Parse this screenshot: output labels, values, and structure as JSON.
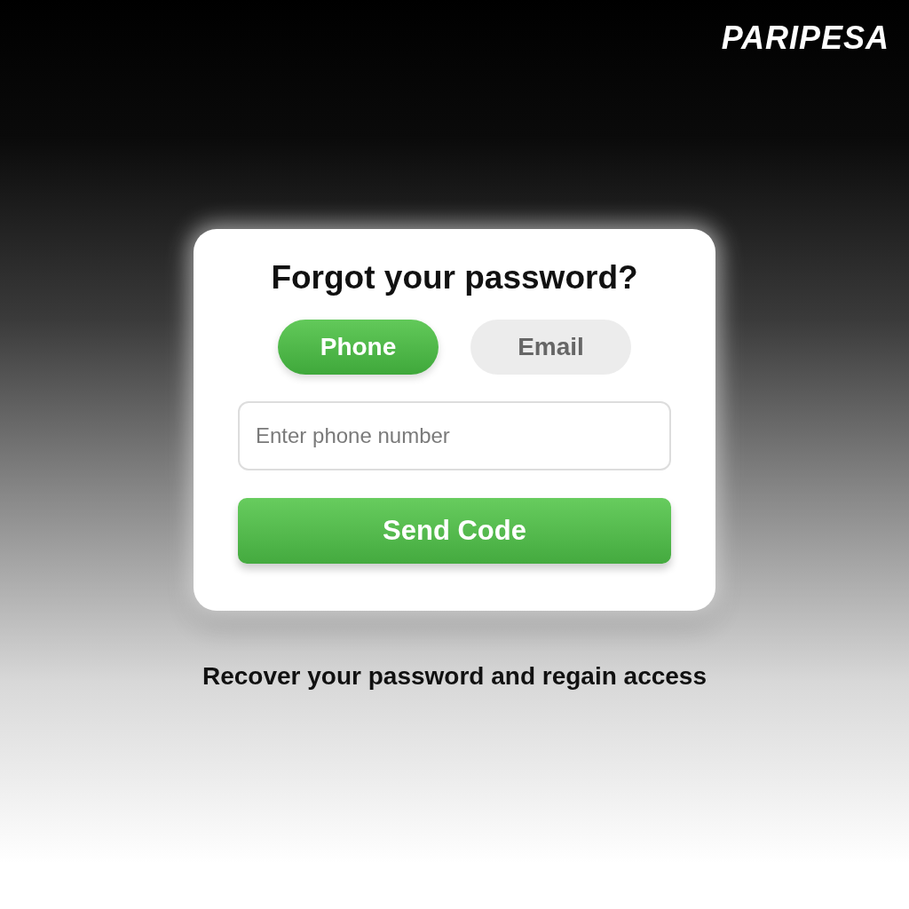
{
  "brand": {
    "logo": "PARIPESA"
  },
  "card": {
    "title": "Forgot your password?",
    "tabs": [
      {
        "label": "Phone",
        "selected": true
      },
      {
        "label": "Email",
        "selected": false
      }
    ],
    "field": {
      "placeholder": "Enter phone number"
    },
    "button": "Send Code"
  },
  "caption": "Recover your password and regain access"
}
